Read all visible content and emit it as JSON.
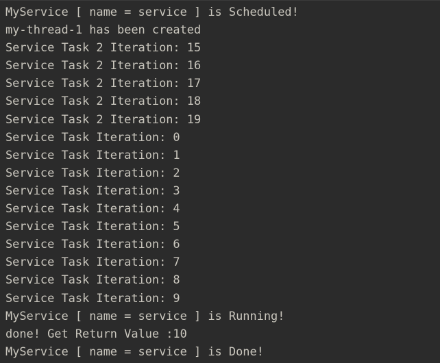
{
  "console": {
    "background_color": "#2b2b2b",
    "text_color": "#c9c6bd",
    "divider_color": "#3a3a3a",
    "lines": [
      {
        "text": "MyService [ name = service ] is Scheduled!"
      },
      {
        "text": "my-thread-1 has been created"
      },
      {
        "text": "Service Task 2 Iteration: 15"
      },
      {
        "text": "Service Task 2 Iteration: 16"
      },
      {
        "text": "Service Task 2 Iteration: 17"
      },
      {
        "text": "Service Task 2 Iteration: 18"
      },
      {
        "text": "Service Task 2 Iteration: 19"
      },
      {
        "text": "Service Task Iteration: 0"
      },
      {
        "text": "Service Task Iteration: 1"
      },
      {
        "text": "Service Task Iteration: 2"
      },
      {
        "text": "Service Task Iteration: 3"
      },
      {
        "text": "Service Task Iteration: 4"
      },
      {
        "text": "Service Task Iteration: 5"
      },
      {
        "text": "Service Task Iteration: 6"
      },
      {
        "text": "Service Task Iteration: 7"
      },
      {
        "text": "Service Task Iteration: 8"
      },
      {
        "text": "Service Task Iteration: 9"
      },
      {
        "text": "MyService [ name = service ] is Running!"
      },
      {
        "text": "done! Get Return Value :10"
      },
      {
        "text": "MyService [ name = service ] is Done!"
      }
    ]
  }
}
